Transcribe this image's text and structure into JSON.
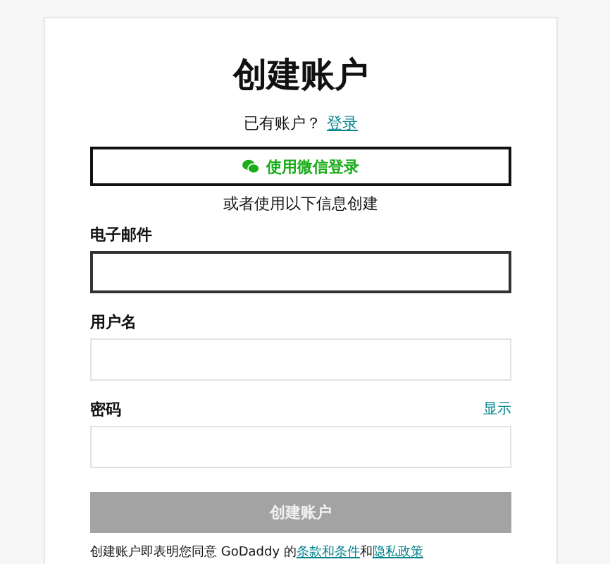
{
  "title": "创建账户",
  "signin_prompt": {
    "text": "已有账户？",
    "link": "登录"
  },
  "wechat_button": {
    "label": "使用微信登录"
  },
  "divider_text": "或者使用以下信息创建",
  "fields": [
    {
      "label": "电子邮件",
      "focused": true
    },
    {
      "label": "用户名",
      "focused": false
    },
    {
      "label": "密码",
      "focused": false,
      "toggle": "显示"
    }
  ],
  "submit_button": {
    "label": "创建账户",
    "disabled": true
  },
  "terms": {
    "text": "创建账户即表明您同意 GoDaddy 的",
    "link_1": "条款和条件",
    "joiner": "和",
    "link_2": "隐私政策"
  }
}
